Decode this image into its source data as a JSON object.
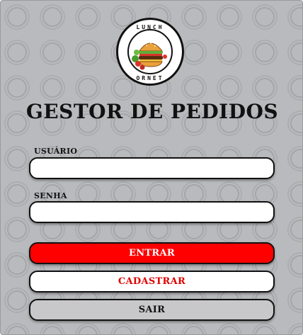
{
  "logo": {
    "ring_text_top": "LUNCH",
    "ring_text_bottom": "ORNET"
  },
  "title": "GESTOR DE PEDIDOS",
  "form": {
    "username_label": "USUÁRIO",
    "username_value": "",
    "password_label": "SENHA",
    "password_value": ""
  },
  "buttons": {
    "login_label": "ENTRAR",
    "register_label": "CADASTRAR",
    "exit_label": "SAIR"
  },
  "colors": {
    "background": "#b9babd",
    "login_button": "#ff0000",
    "register_text": "#e00000",
    "exit_button": "#c8c8ca"
  }
}
